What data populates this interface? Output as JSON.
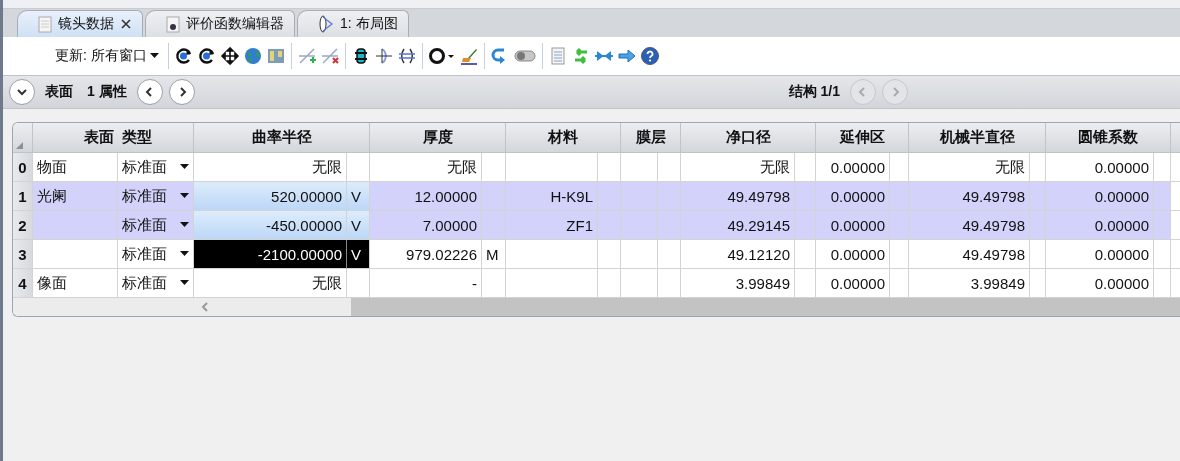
{
  "tabs": [
    {
      "label": "镜头数据",
      "selected": true,
      "closable": true,
      "kind": "sheet"
    },
    {
      "label": "评价函数编辑器",
      "selected": false,
      "closable": false,
      "kind": "merit"
    },
    {
      "label": "1: 布局图",
      "selected": false,
      "closable": false,
      "kind": "layout"
    }
  ],
  "toolbar": {
    "update_label": "更新: 所有窗口"
  },
  "navigator": {
    "section": "表面",
    "properties": "1 属性",
    "config": "结构 1/1",
    "config_nav_disabled": true
  },
  "table": {
    "columns": [
      "表面",
      "类型",
      "曲率半径",
      "厚度",
      "材料",
      "膜层",
      "净口径",
      "延伸区",
      "机械半直径",
      "圆锥系数"
    ],
    "rows": [
      {
        "index": "0",
        "selected": false,
        "radius_highlighted": false,
        "radius_focused": false,
        "cells": [
          {
            "value": "物面"
          },
          {
            "value": "标准面",
            "kind": "dropdown"
          },
          {
            "value": "无限"
          },
          {
            "value": "无限"
          },
          {},
          {},
          {
            "value": "无限"
          },
          {
            "value": "0.00000"
          },
          {
            "value": "无限"
          },
          {
            "value": "0.00000"
          }
        ]
      },
      {
        "index": "1",
        "selected": true,
        "radius_highlighted": true,
        "radius_focused": false,
        "cells": [
          {
            "value": "光阑"
          },
          {
            "value": "标准面",
            "kind": "dropdown"
          },
          {
            "value": "520.00000",
            "flag": "V"
          },
          {
            "value": "12.00000"
          },
          {
            "value": "H-K9L"
          },
          {},
          {
            "value": "49.49798"
          },
          {
            "value": "0.00000"
          },
          {
            "value": "49.49798"
          },
          {
            "value": "0.00000"
          }
        ]
      },
      {
        "index": "2",
        "selected": true,
        "radius_highlighted": true,
        "radius_focused": false,
        "cells": [
          {},
          {
            "value": "标准面",
            "kind": "dropdown"
          },
          {
            "value": "-450.00000",
            "flag": "V"
          },
          {
            "value": "7.00000"
          },
          {
            "value": "ZF1"
          },
          {},
          {
            "value": "49.29145"
          },
          {
            "value": "0.00000"
          },
          {
            "value": "49.49798"
          },
          {
            "value": "0.00000"
          }
        ]
      },
      {
        "index": "3",
        "selected": false,
        "radius_highlighted": false,
        "radius_focused": true,
        "cells": [
          {},
          {
            "value": "标准面",
            "kind": "dropdown"
          },
          {
            "value": "-2100.00000",
            "flag": "V"
          },
          {
            "value": "979.02226",
            "flag": "M"
          },
          {},
          {},
          {
            "value": "49.12120"
          },
          {
            "value": "0.00000"
          },
          {
            "value": "49.49798"
          },
          {
            "value": "0.00000"
          }
        ]
      },
      {
        "index": "4",
        "selected": false,
        "radius_highlighted": false,
        "radius_focused": false,
        "cells": [
          {
            "value": "像面"
          },
          {
            "value": "标准面",
            "kind": "dropdown"
          },
          {
            "value": "无限"
          },
          {
            "value": "-"
          },
          {},
          {},
          {
            "value": "3.99849"
          },
          {
            "value": "0.00000"
          },
          {
            "value": "3.99849"
          },
          {
            "value": "0.00000"
          }
        ]
      }
    ]
  }
}
